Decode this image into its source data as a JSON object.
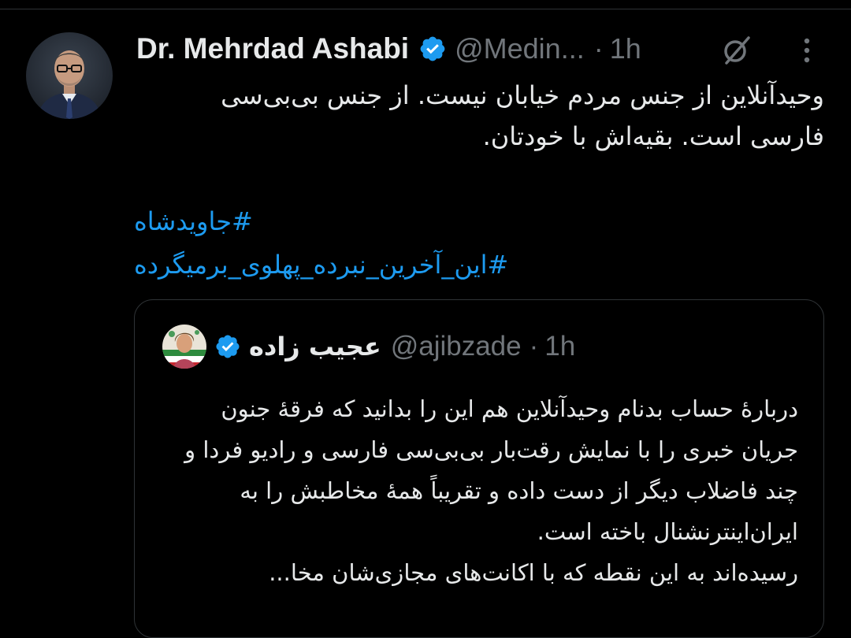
{
  "post": {
    "author": {
      "name": "Dr. Mehrdad Ashabi",
      "handle": "@Medin...",
      "verified": true,
      "avatar": "profile-photo"
    },
    "separator": "·",
    "time": "1h",
    "icons": {
      "grok": "grok-icon",
      "more": "more-vertical-icon"
    },
    "text": "وحیدآنلاین از جنس مردم خیابان نیست. از جنس بی‌بی‌سی فارسی است. بقیه‌اش با خودتان.",
    "hashtags": [
      "#جاویدشاه",
      "#این_آخرین_نبرده_پهلوی_برمیگرده"
    ]
  },
  "quote": {
    "author": {
      "name": "عجیب زاده",
      "handle": "@ajibzade",
      "verified": true,
      "avatar": "profile-photo"
    },
    "separator": "·",
    "time": "1h",
    "paragraphs": [
      "دربارهٔ حساب بدنام وحیدآنلاین هم این را بدانید که فرقهٔ جنون جریان خبری را با نمایش رقت‌بار بی‌بی‌سی فارسی و رادیو فردا و چند فاضلاب دیگر از دست داده و تقریباً همهٔ مخاطبش را به ایران‌اینترنشنال باخته است.",
      "رسیده‌اند به این نقطه که با اکانت‌های مجازی‌شان مخا..."
    ]
  },
  "colors": {
    "background": "#000000",
    "text": "#e7e9ea",
    "secondary_text": "#71767b",
    "link": "#1d9bf0",
    "verified_badge": "#1d9bf0",
    "border": "#2f3336"
  }
}
